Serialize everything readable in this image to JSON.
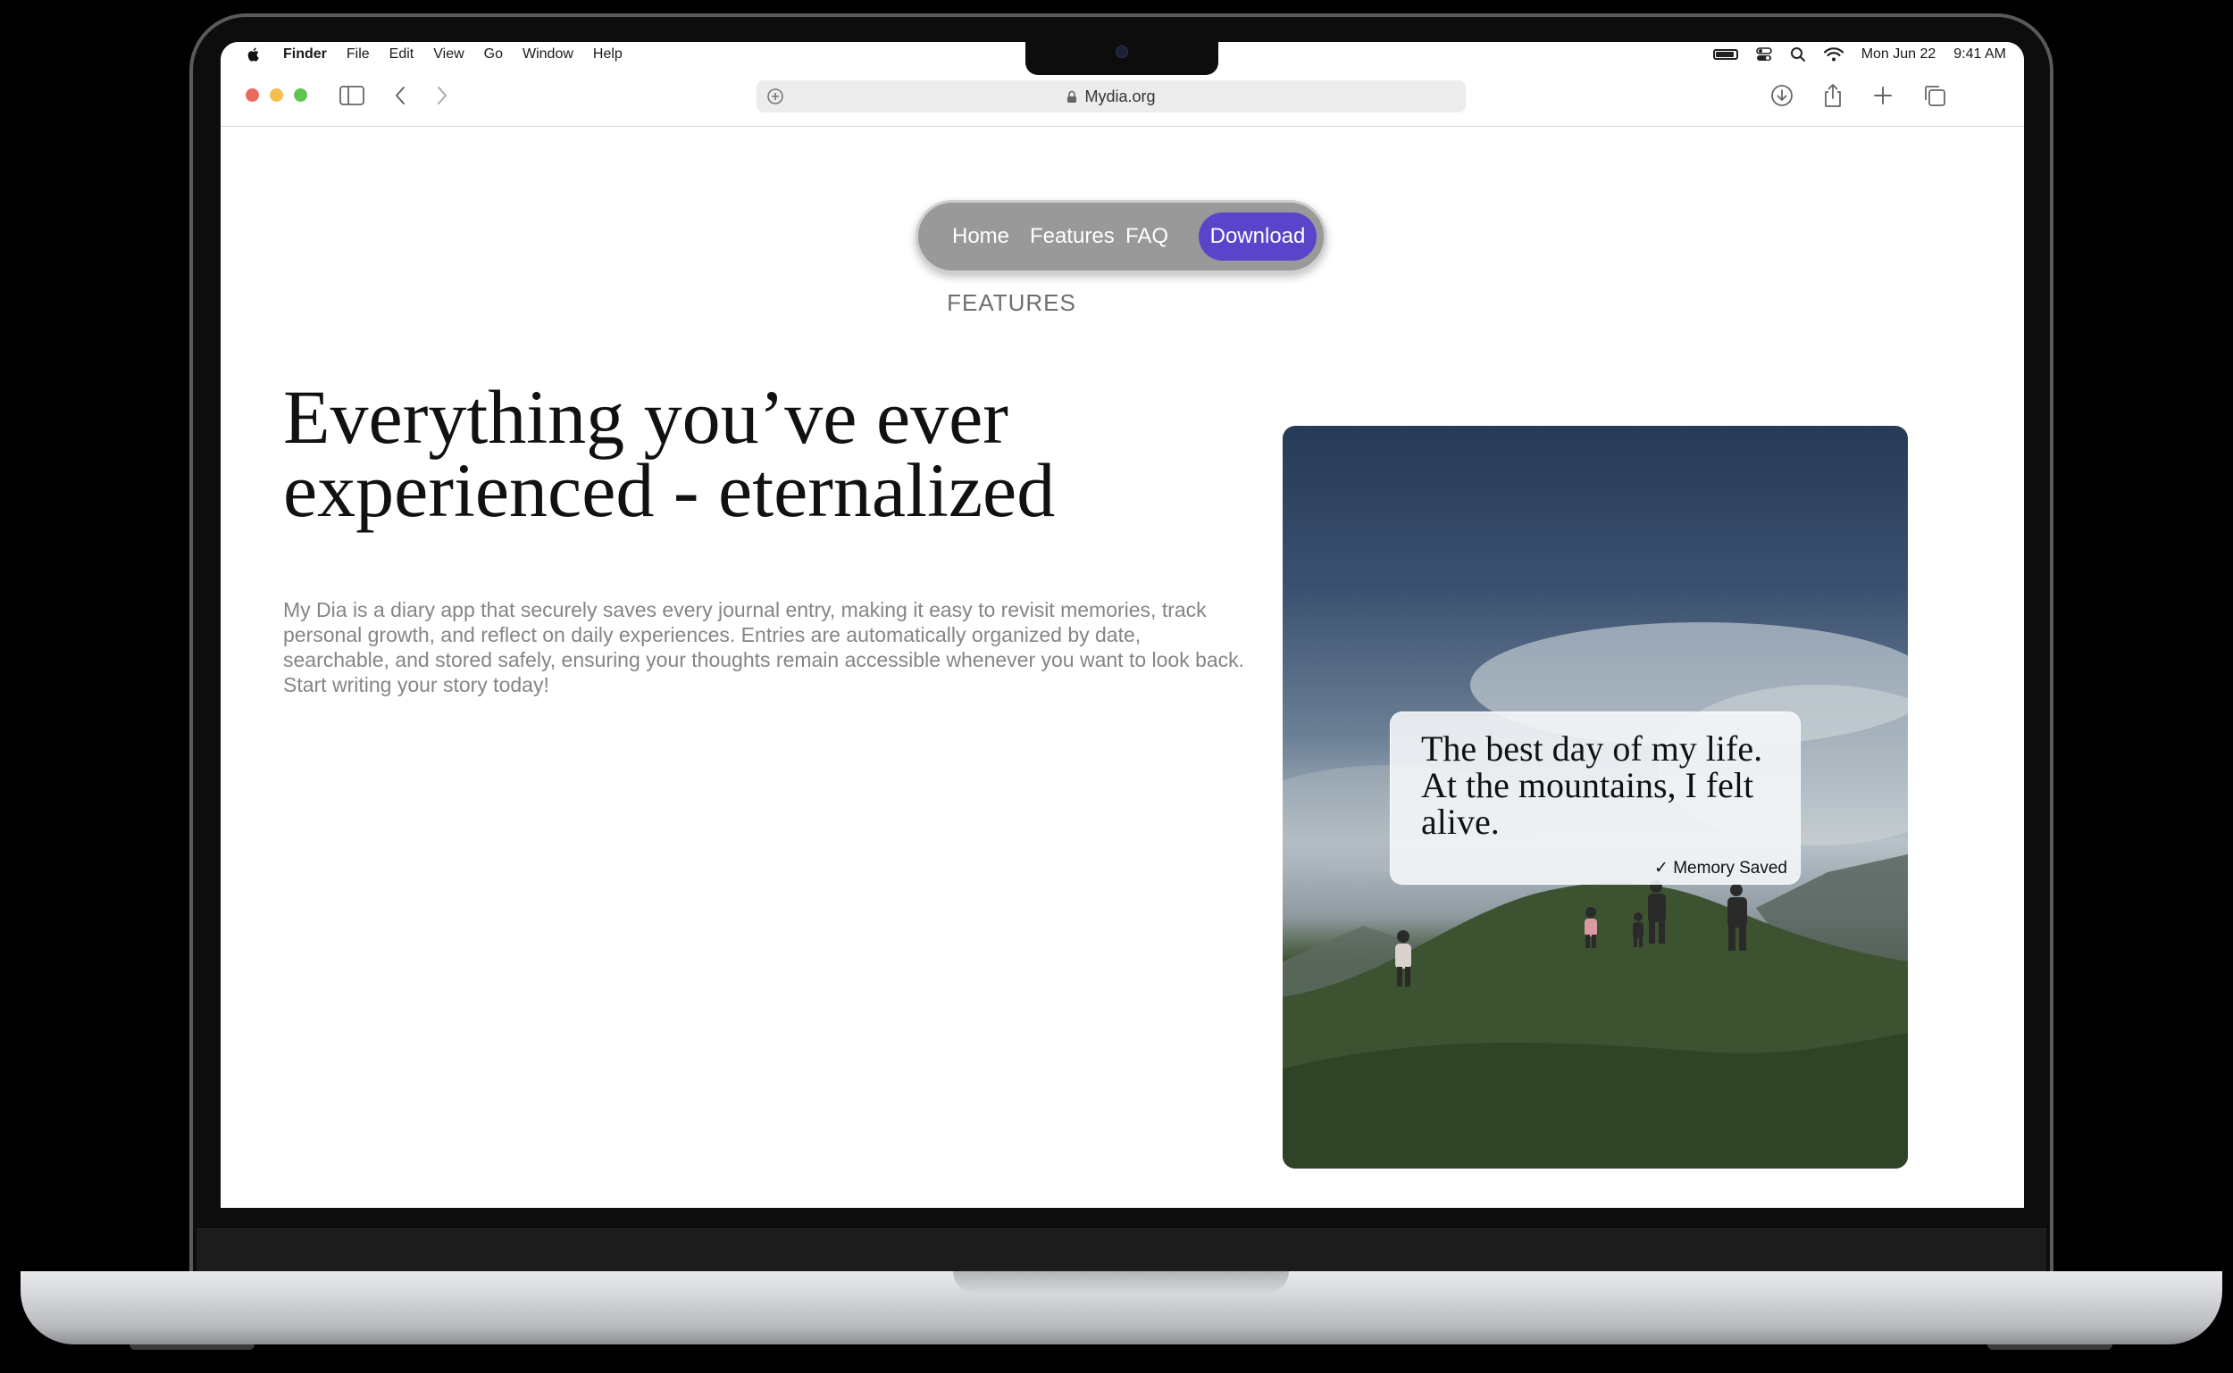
{
  "menubar": {
    "app_name": "Finder",
    "items": [
      "File",
      "Edit",
      "View",
      "Go",
      "Window",
      "Help"
    ],
    "date": "Mon Jun 22",
    "time": "9:41 AM",
    "icons": [
      "apple-logo",
      "battery-icon",
      "control-center-icon",
      "search-icon",
      "wifi-icon"
    ]
  },
  "browser": {
    "url": "Mydia.org",
    "toolbar_icons": [
      "sidebar-icon",
      "back-icon",
      "forward-icon",
      "site-settings-icon",
      "lock-icon",
      "download-icon",
      "share-icon",
      "new-tab-icon",
      "tab-overview-icon"
    ]
  },
  "nav": {
    "home": "Home",
    "features": "Features",
    "faq": "FAQ",
    "download": "Download"
  },
  "section_label": "FEATURES",
  "hero": {
    "headline": "Everything you’ve ever experienced - eternalized",
    "description": "My Dia is a diary app that securely saves every journal entry, making it easy to revisit memories, track personal growth, and reflect on daily experiences. Entries are automatically organized by date, searchable, and stored safely, ensuring your thoughts remain accessible whenever you want to look back. Start writing your story today!"
  },
  "memory_card": {
    "text": "The best day of my life. At the mountains, I felt alive.",
    "status": "✓ Memory Saved"
  },
  "colors": {
    "accent": "#5a44c9",
    "nav_pill": "#999999",
    "muted_text": "#858585"
  }
}
